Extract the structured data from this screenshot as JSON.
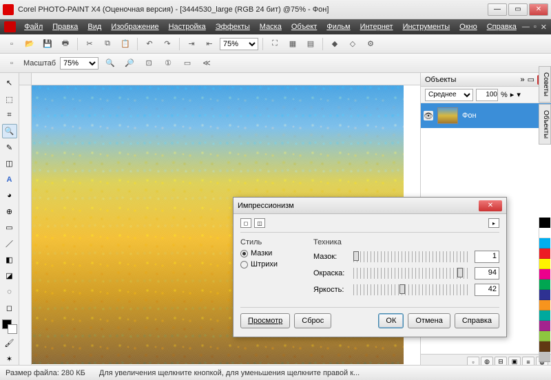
{
  "window": {
    "title": "Corel PHOTO-PAINT X4 (Оценочная версия) - [3444530_large (RGB 24 бит) @75% - Фон]"
  },
  "menu": [
    "Файл",
    "Правка",
    "Вид",
    "Изображение",
    "Настройка",
    "Эффекты",
    "Маска",
    "Объект",
    "Фильм",
    "Интернет",
    "Инструменты",
    "Окно",
    "Справка"
  ],
  "toolbar": {
    "zoom_value": "75%"
  },
  "propbar": {
    "zoom_label": "Масштаб",
    "zoom_value": "75%"
  },
  "objects_panel": {
    "title": "Объекты",
    "blend_mode": "Среднее",
    "opacity": "100",
    "percent": "%",
    "layer_name": "Фон"
  },
  "side_tabs": [
    "Советы",
    "Объекты"
  ],
  "palette": [
    "#000000",
    "#ffffff",
    "#00aeef",
    "#ed1c24",
    "#fff200",
    "#ec008c",
    "#00a651",
    "#2e3192",
    "#f7941d",
    "#00a99d",
    "#a3238e",
    "#8dc63f",
    "#603913",
    "#c0c0c0"
  ],
  "statusbar": {
    "filesize_label": "Размер файла:",
    "filesize_value": "280 КБ",
    "hint": "Для увеличения щелкните кнопкой, для уменьшения щелкните правой к..."
  },
  "dialog": {
    "title": "Импрессионизм",
    "style_label": "Стиль",
    "style_options": {
      "mazki": "Мазки",
      "shtrikhi": "Штрихи"
    },
    "style_selected": "mazki",
    "technique_label": "Техника",
    "rows": {
      "mazok": {
        "label": "Мазок:",
        "value": "1",
        "pos": 0
      },
      "okraska": {
        "label": "Окраска:",
        "value": "94",
        "pos": 94
      },
      "yarkost": {
        "label": "Яркость:",
        "value": "42",
        "pos": 42
      }
    },
    "buttons": {
      "preview": "Просмотр",
      "reset": "Сброс",
      "ok": "ОК",
      "cancel": "Отмена",
      "help": "Справка"
    }
  }
}
